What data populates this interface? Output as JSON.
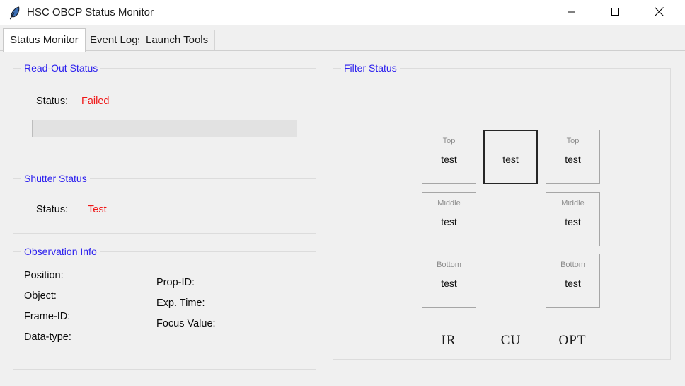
{
  "window": {
    "title": "HSC OBCP Status Monitor",
    "icon": "feather-icon",
    "controls": {
      "minimize": "minimize-icon",
      "maximize": "maximize-icon",
      "close": "close-icon"
    }
  },
  "tabs": [
    {
      "label": "Status Monitor",
      "active": true
    },
    {
      "label": "Event Logs",
      "active": false
    },
    {
      "label": "Launch Tools",
      "active": false
    }
  ],
  "colors": {
    "group_title": "#2b1fee",
    "status_value": "#f01616",
    "box_position": "#8c8c8c",
    "selected_border": "#262626",
    "window_bg": "#f0f0f0"
  },
  "readout_status": {
    "title": "Read-Out Status",
    "status_label": "Status:",
    "status_value": "Failed",
    "progress_value": ""
  },
  "shutter_status": {
    "title": "Shutter Status",
    "status_label": "Status:",
    "status_value": "Test"
  },
  "observation_info": {
    "title": "Observation Info",
    "left_column": [
      {
        "label": "Position:",
        "value": ""
      },
      {
        "label": "Object:",
        "value": ""
      },
      {
        "label": "Frame-ID:",
        "value": ""
      },
      {
        "label": "Data-type:",
        "value": ""
      }
    ],
    "right_column": [
      {
        "label": "Prop-ID:",
        "value": ""
      },
      {
        "label": "Exp. Time:",
        "value": ""
      },
      {
        "label": "Focus Value:",
        "value": ""
      }
    ]
  },
  "filter_status": {
    "title": "Filter Status",
    "columns": [
      {
        "name": "IR",
        "boxes": [
          {
            "position": "Top",
            "filter": "test",
            "selected": false
          },
          {
            "position": "Middle",
            "filter": "test",
            "selected": false
          },
          {
            "position": "Bottom",
            "filter": "test",
            "selected": false
          }
        ]
      },
      {
        "name": "CU",
        "boxes": [
          {
            "position": "",
            "filter": "test",
            "selected": true
          }
        ]
      },
      {
        "name": "OPT",
        "boxes": [
          {
            "position": "Top",
            "filter": "test",
            "selected": false
          },
          {
            "position": "Middle",
            "filter": "test",
            "selected": false
          },
          {
            "position": "Bottom",
            "filter": "test",
            "selected": false
          }
        ]
      }
    ]
  }
}
